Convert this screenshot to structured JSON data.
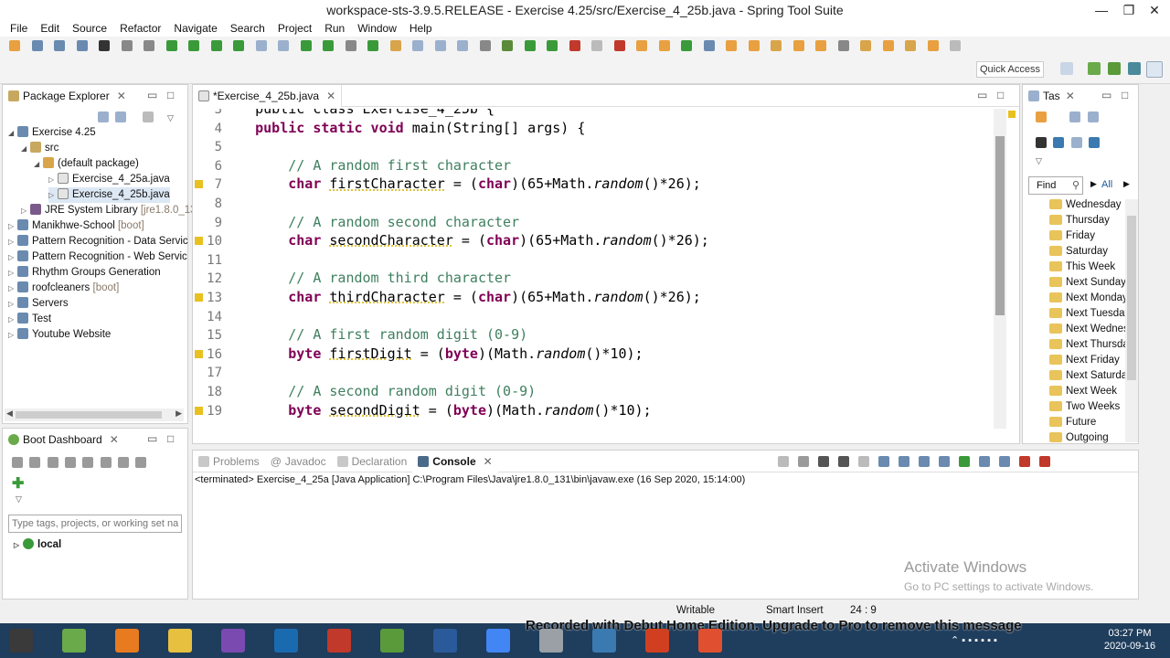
{
  "window": {
    "title": "workspace-sts-3.9.5.RELEASE - Exercise 4.25/src/Exercise_4_25b.java - Spring Tool Suite",
    "minimize": "—",
    "restore": "❐",
    "close": "✕"
  },
  "menu": [
    "File",
    "Edit",
    "Source",
    "Refactor",
    "Navigate",
    "Search",
    "Project",
    "Run",
    "Window",
    "Help"
  ],
  "quick_access": "Quick Access",
  "package_explorer": {
    "title": "Package Explorer",
    "project": "Exercise 4.25",
    "src": "src",
    "default_package": "(default package)",
    "files": [
      "Exercise_4_25a.java",
      "Exercise_4_25b.java"
    ],
    "jre": "JRE System Library",
    "jre_version": "[jre1.8.0_13",
    "projects": [
      {
        "name": "Manikhwe-School",
        "tag": "[boot]"
      },
      {
        "name": "Pattern Recognition - Data Servic",
        "tag": ""
      },
      {
        "name": "Pattern Recognition - Web Servic",
        "tag": ""
      },
      {
        "name": "Rhythm Groups Generation",
        "tag": ""
      },
      {
        "name": "roofcleaners",
        "tag": "[boot]"
      },
      {
        "name": "Servers",
        "tag": ""
      },
      {
        "name": "Test",
        "tag": ""
      },
      {
        "name": "Youtube Website",
        "tag": ""
      }
    ]
  },
  "boot_dashboard": {
    "title": "Boot Dashboard",
    "filter_placeholder": "Type tags, projects, or working set na",
    "local": "local"
  },
  "editor": {
    "tab": "*Exercise_4_25b.java",
    "lines": [
      {
        "n": "3",
        "partial": "public class Exercise_4_25b {"
      },
      {
        "n": "4",
        "type": "method",
        "text_pre": "public static void ",
        "name": "main",
        "args": "(String[] args) {"
      },
      {
        "n": "5"
      },
      {
        "n": "6",
        "comment": "// A random first character"
      },
      {
        "n": "7",
        "kw": "char",
        "var": "firstCharacter",
        "mid": " = (",
        "cast": "char",
        "post": ")(65+Math.",
        "fn": "random",
        "end": "()*26);"
      },
      {
        "n": "8"
      },
      {
        "n": "9",
        "comment": "// A random second character"
      },
      {
        "n": "10",
        "kw": "char",
        "var": "secondCharacter",
        "mid": " = (",
        "cast": "char",
        "post": ")(65+Math.",
        "fn": "random",
        "end": "()*26);"
      },
      {
        "n": "11"
      },
      {
        "n": "12",
        "comment": "// A random third character"
      },
      {
        "n": "13",
        "kw": "char",
        "var": "thirdCharacter",
        "mid": " = (",
        "cast": "char",
        "post": ")(65+Math.",
        "fn": "random",
        "end": "()*26);"
      },
      {
        "n": "14"
      },
      {
        "n": "15",
        "comment": "// A first random digit (0-9)"
      },
      {
        "n": "16",
        "kw": "byte",
        "var": "firstDigit",
        "mid": " = (",
        "cast": "byte",
        "post": ")(Math.",
        "fn": "random",
        "end": "()*10);"
      },
      {
        "n": "17"
      },
      {
        "n": "18",
        "comment": "// A second random digit (0-9)"
      },
      {
        "n": "19",
        "kw": "byte",
        "var": "secondDigit",
        "mid": " = (",
        "cast": "byte",
        "post": ")(Math.",
        "fn": "random",
        "end": "()*10);"
      }
    ]
  },
  "tasks": {
    "title": "Tas",
    "find_placeholder": "Find",
    "all": "All",
    "items": [
      "Wednesday",
      "Thursday",
      "Friday",
      "Saturday",
      "This Week",
      "Next Sunday",
      "Next Monday",
      "Next Tuesday",
      "Next Wednesday",
      "Next Thursday",
      "Next Friday",
      "Next Saturday",
      "Next Week",
      "Two Weeks",
      "Future",
      "Outgoing"
    ]
  },
  "bottom": {
    "tabs": [
      "Problems",
      "Javadoc",
      "Declaration",
      "Console"
    ],
    "console_status": "<terminated> Exercise_4_25a [Java Application] C:\\Program Files\\Java\\jre1.8.0_131\\bin\\javaw.exe (16 Sep 2020, 15:14:00)"
  },
  "watermark": {
    "line1": "Activate Windows",
    "line2": "Go to PC settings to activate Windows."
  },
  "status": {
    "writable": "Writable",
    "insert": "Smart Insert",
    "pos": "24 : 9",
    "recorded": "Recorded with Debut Home Edition. Upgrade to Pro to remove this message"
  },
  "clock": {
    "time": "03:27 PM",
    "date": "2020-09-16"
  },
  "colors": {
    "keyword": "#7f0055",
    "comment": "#3f7f5f",
    "taskbar": "#1f3d5c"
  }
}
